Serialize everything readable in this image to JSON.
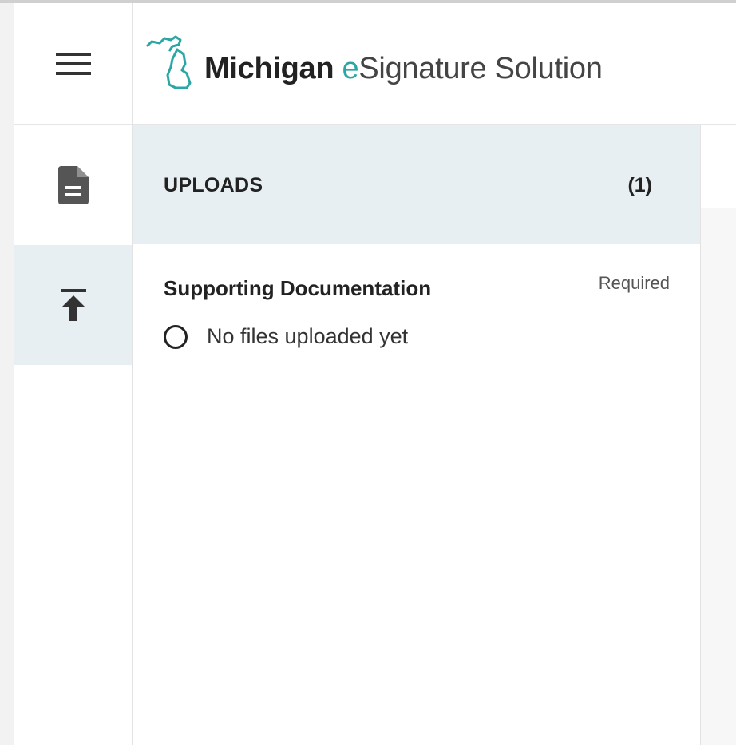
{
  "header": {
    "logo_bold": "Michigan",
    "logo_e": "e",
    "logo_rest": "Signature Solution",
    "menu_icon": "hamburger-menu-icon"
  },
  "rail": {
    "items": [
      {
        "icon": "document-icon",
        "active": false
      },
      {
        "icon": "upload-icon",
        "active": true
      }
    ]
  },
  "uploads": {
    "title": "UPLOADS",
    "count": "(1)",
    "items": [
      {
        "name": "Supporting Documentation",
        "requirement": "Required",
        "status": "No files uploaded yet"
      }
    ]
  },
  "colors": {
    "accent": "#2aa7a5",
    "panel_header_bg": "#e7eff2",
    "text": "#222222"
  }
}
